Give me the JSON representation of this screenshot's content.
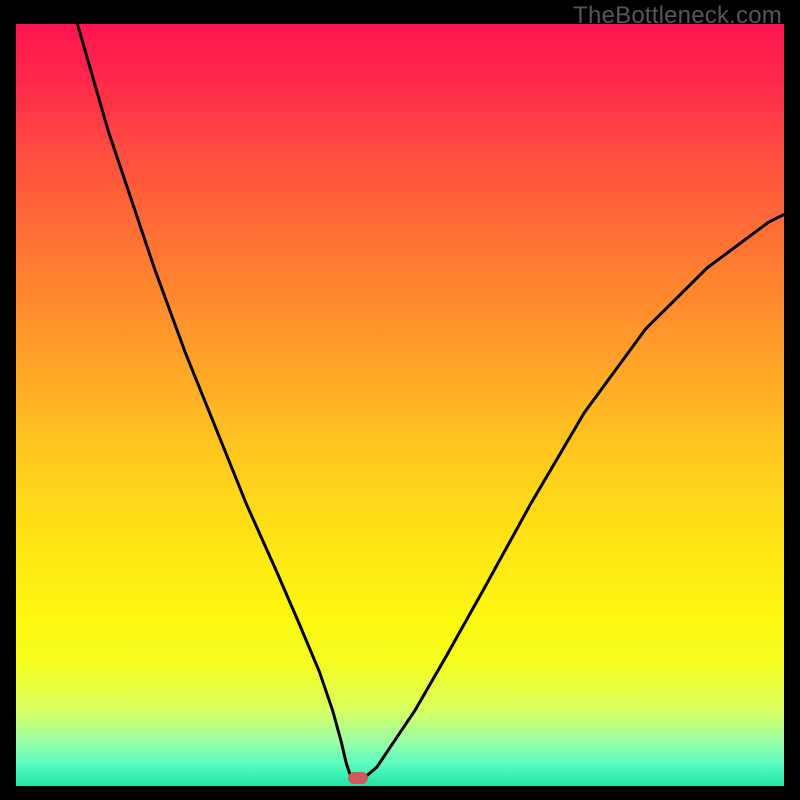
{
  "watermark": "TheBottleneck.com",
  "chart_data": {
    "type": "line",
    "title": "",
    "xlabel": "",
    "ylabel": "",
    "xlim": [
      0,
      100
    ],
    "ylim": [
      0,
      100
    ],
    "series": [
      {
        "name": "curve",
        "x": [
          8,
          10,
          12,
          15,
          18,
          22,
          26,
          30,
          34,
          37,
          39.5,
          41.2,
          42.3,
          43.0,
          43.5,
          44.0,
          45.5,
          47.0,
          49.0,
          52.0,
          56.0,
          61.0,
          67.0,
          74.0,
          82.0,
          90.0,
          98.0,
          100.0
        ],
        "values": [
          100,
          93,
          86,
          77,
          68,
          57,
          47,
          37,
          28,
          21,
          15,
          10,
          6,
          3,
          1.5,
          1.2,
          1.2,
          2.5,
          5.5,
          10,
          17,
          26,
          37,
          49,
          60,
          68,
          74,
          75
        ]
      }
    ],
    "marker": {
      "x": 44.5,
      "y": 1.0
    },
    "grid": false,
    "legend": false
  },
  "colors": {
    "curve_stroke": "#000000",
    "marker_fill": "#cf5a59"
  }
}
